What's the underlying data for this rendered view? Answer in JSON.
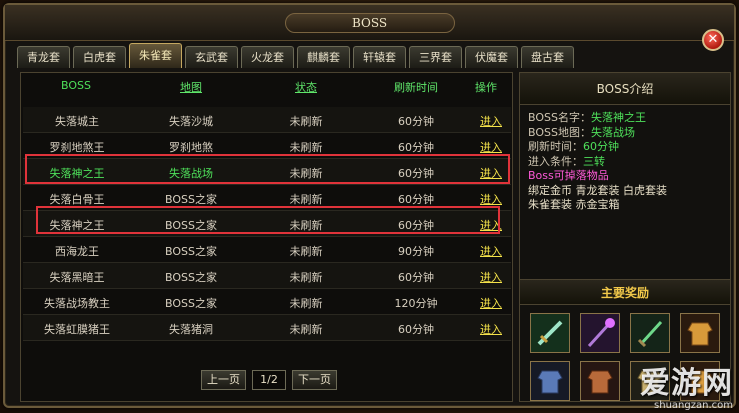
{
  "window": {
    "title": "BOSS"
  },
  "tabs": [
    {
      "label": "青龙套",
      "active": false
    },
    {
      "label": "白虎套",
      "active": false
    },
    {
      "label": "朱雀套",
      "active": true
    },
    {
      "label": "玄武套",
      "active": false
    },
    {
      "label": "火龙套",
      "active": false
    },
    {
      "label": "麒麟套",
      "active": false
    },
    {
      "label": "轩辕套",
      "active": false
    },
    {
      "label": "三界套",
      "active": false
    },
    {
      "label": "伏魔套",
      "active": false
    },
    {
      "label": "盘古套",
      "active": false
    }
  ],
  "table": {
    "headers": {
      "boss": "BOSS",
      "map": "地图",
      "status": "状态",
      "refresh": "刷新时间",
      "op": "操作"
    },
    "rows": [
      {
        "name": "失落城主",
        "map": "失落沙城",
        "status": "未刷新",
        "time": "60分钟",
        "op": "进入"
      },
      {
        "name": "罗刹地煞王",
        "map": "罗刹地煞",
        "status": "未刷新",
        "time": "60分钟",
        "op": "进入"
      },
      {
        "name": "失落神之王",
        "map": "失落战场",
        "status": "未刷新",
        "time": "60分钟",
        "op": "进入"
      },
      {
        "name": "失落白骨王",
        "map": "BOSS之家",
        "status": "未刷新",
        "time": "60分钟",
        "op": "进入"
      },
      {
        "name": "失落神之王",
        "map": "BOSS之家",
        "status": "未刷新",
        "time": "60分钟",
        "op": "进入"
      },
      {
        "name": "西海龙王",
        "map": "BOSS之家",
        "status": "未刷新",
        "time": "90分钟",
        "op": "进入"
      },
      {
        "name": "失落黑暗王",
        "map": "BOSS之家",
        "status": "未刷新",
        "time": "60分钟",
        "op": "进入"
      },
      {
        "name": "失落战场教主",
        "map": "BOSS之家",
        "status": "未刷新",
        "time": "120分钟",
        "op": "进入"
      },
      {
        "name": "失落虹膜猪王",
        "map": "失落猪洞",
        "status": "未刷新",
        "time": "60分钟",
        "op": "进入"
      }
    ]
  },
  "pager": {
    "prev": "上一页",
    "page": "1/2",
    "next": "下一页"
  },
  "info": {
    "title": "BOSS介绍",
    "name_label": "BOSS名字：",
    "name_value": "失落神之王",
    "map_label": "BOSS地图：",
    "map_value": "失落战场",
    "refresh_label": "刷新时间：",
    "refresh_value": "60分钟",
    "cond_label": "进入条件：",
    "cond_value": "三转",
    "drop_title": "Boss可掉落物品",
    "drop_line1": "绑定金币 青龙套装 白虎套装",
    "drop_line2": "朱雀套装 赤金宝箱"
  },
  "rewards": {
    "title": "主要奖励",
    "icons": [
      "sword-icon",
      "staff-icon",
      "blade-icon",
      "armor-icon",
      "armor-icon",
      "armor-icon",
      "armor-icon",
      "armor-icon"
    ]
  },
  "watermark": {
    "big": "爱游网",
    "small": "shuangzan.com"
  },
  "colors": {
    "accent_green": "#4ee05a",
    "link_yellow": "#f4e24a",
    "drop_pink": "#ff5ad8",
    "reward_gold": "#f2c94a",
    "highlight_red": "#e0333a"
  }
}
